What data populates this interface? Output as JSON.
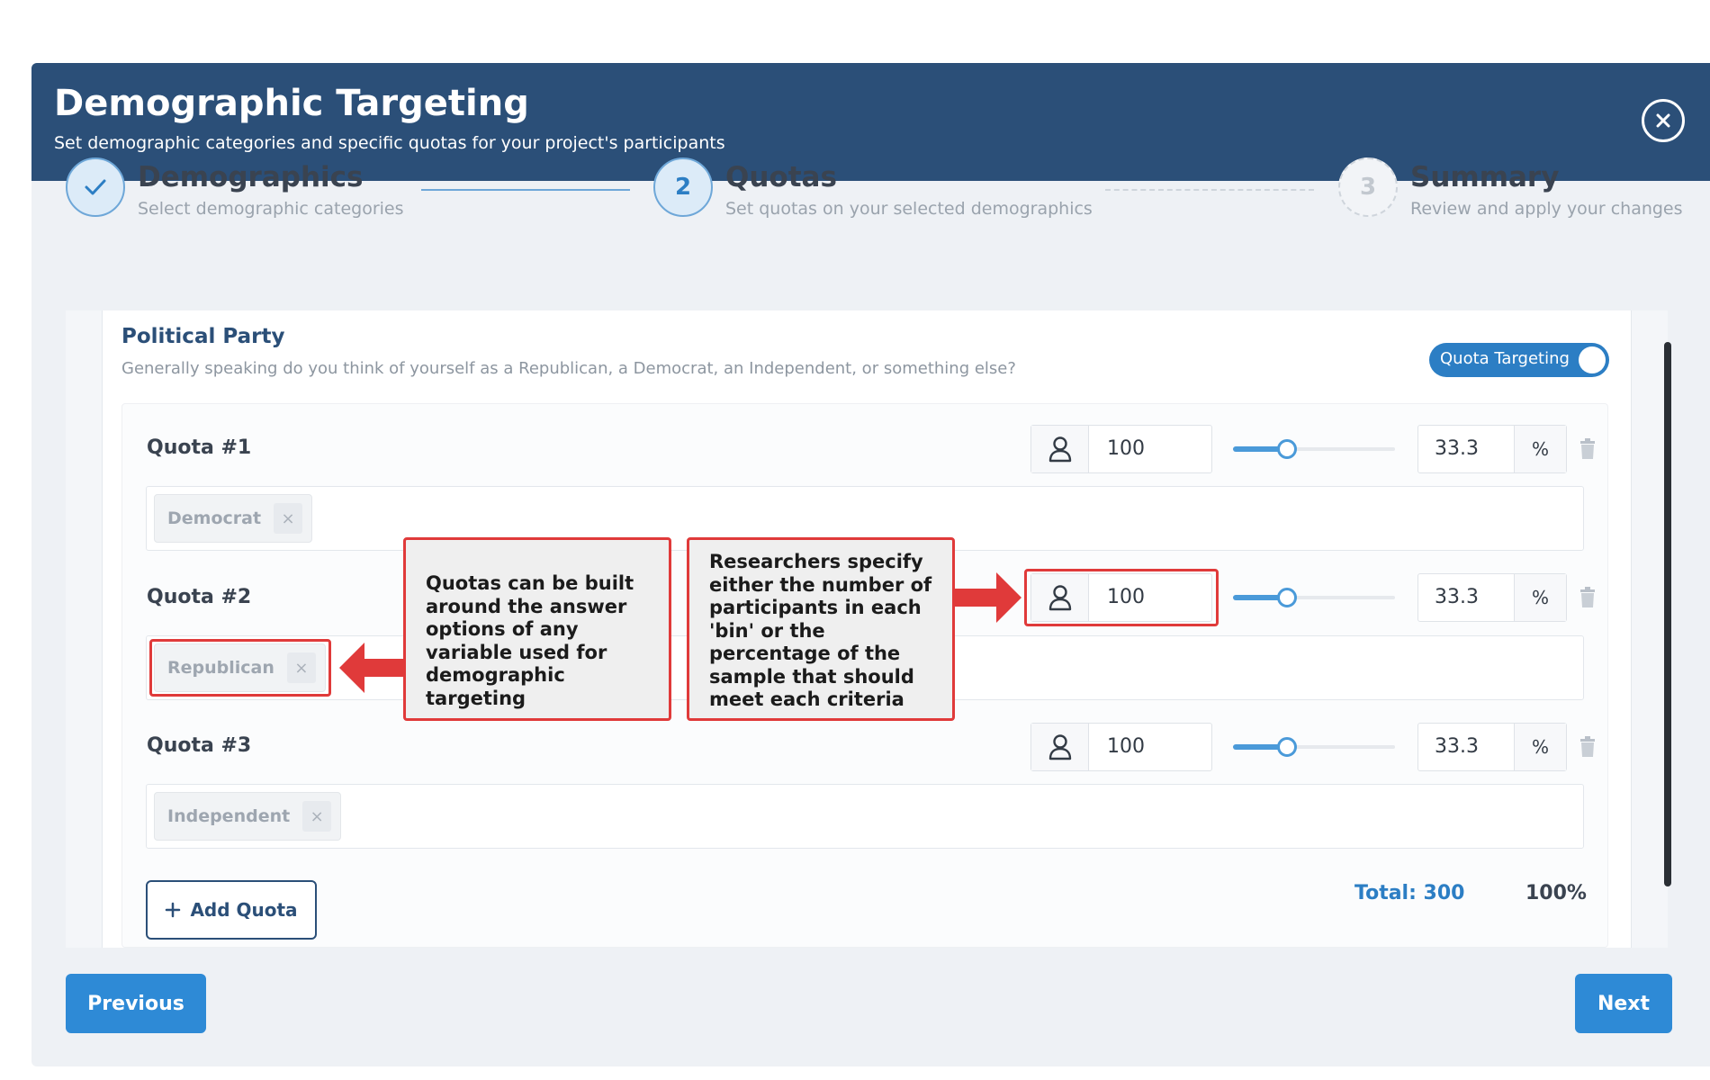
{
  "header": {
    "title": "Demographic Targeting",
    "subtitle": "Set demographic categories and specific quotas for your project's participants"
  },
  "steps": [
    {
      "number": "",
      "title": "Demographics",
      "description": "Select demographic categories",
      "state": "completed"
    },
    {
      "number": "2",
      "title": "Quotas",
      "description": "Set quotas on your selected demographics",
      "state": "active"
    },
    {
      "number": "3",
      "title": "Summary",
      "description": "Review and apply your changes",
      "state": "pending"
    }
  ],
  "section": {
    "title": "Political Party",
    "question": "Generally speaking do you think of yourself as a Republican, a Democrat, an Independent, or something else?",
    "toggle_label": "Quota Targeting",
    "toggle_on": true
  },
  "quotas": [
    {
      "label": "Quota #1",
      "count": "100",
      "percent": "33.3",
      "slider_fraction": 0.333,
      "tag": "Democrat"
    },
    {
      "label": "Quota #2",
      "count": "100",
      "percent": "33.3",
      "slider_fraction": 0.333,
      "tag": "Republican"
    },
    {
      "label": "Quota #3",
      "count": "100",
      "percent": "33.3",
      "slider_fraction": 0.333,
      "tag": "Independent"
    }
  ],
  "percent_symbol": "%",
  "tag_remove_glyph": "×",
  "add_quota_label": "Add Quota",
  "total_label": "Total: 300",
  "total_percent": "100%",
  "footer": {
    "previous_label": "Previous",
    "next_label": "Next"
  },
  "callouts": {
    "quotas_built": "Quotas can be built around the answer options of any variable used for demographic targeting",
    "researchers": "Researchers specify either the number of participants in each 'bin' or the percentage of the sample that should meet each criteria"
  },
  "colors": {
    "header_bg": "#2b4f78",
    "accent": "#2c7ec4",
    "button": "#2e8ad6",
    "annotation_red": "#e03a3a"
  },
  "icons": [
    "close-icon",
    "check-icon",
    "user-icon",
    "trash-icon",
    "plus-icon",
    "arrow-right-icon",
    "arrow-left-icon"
  ]
}
